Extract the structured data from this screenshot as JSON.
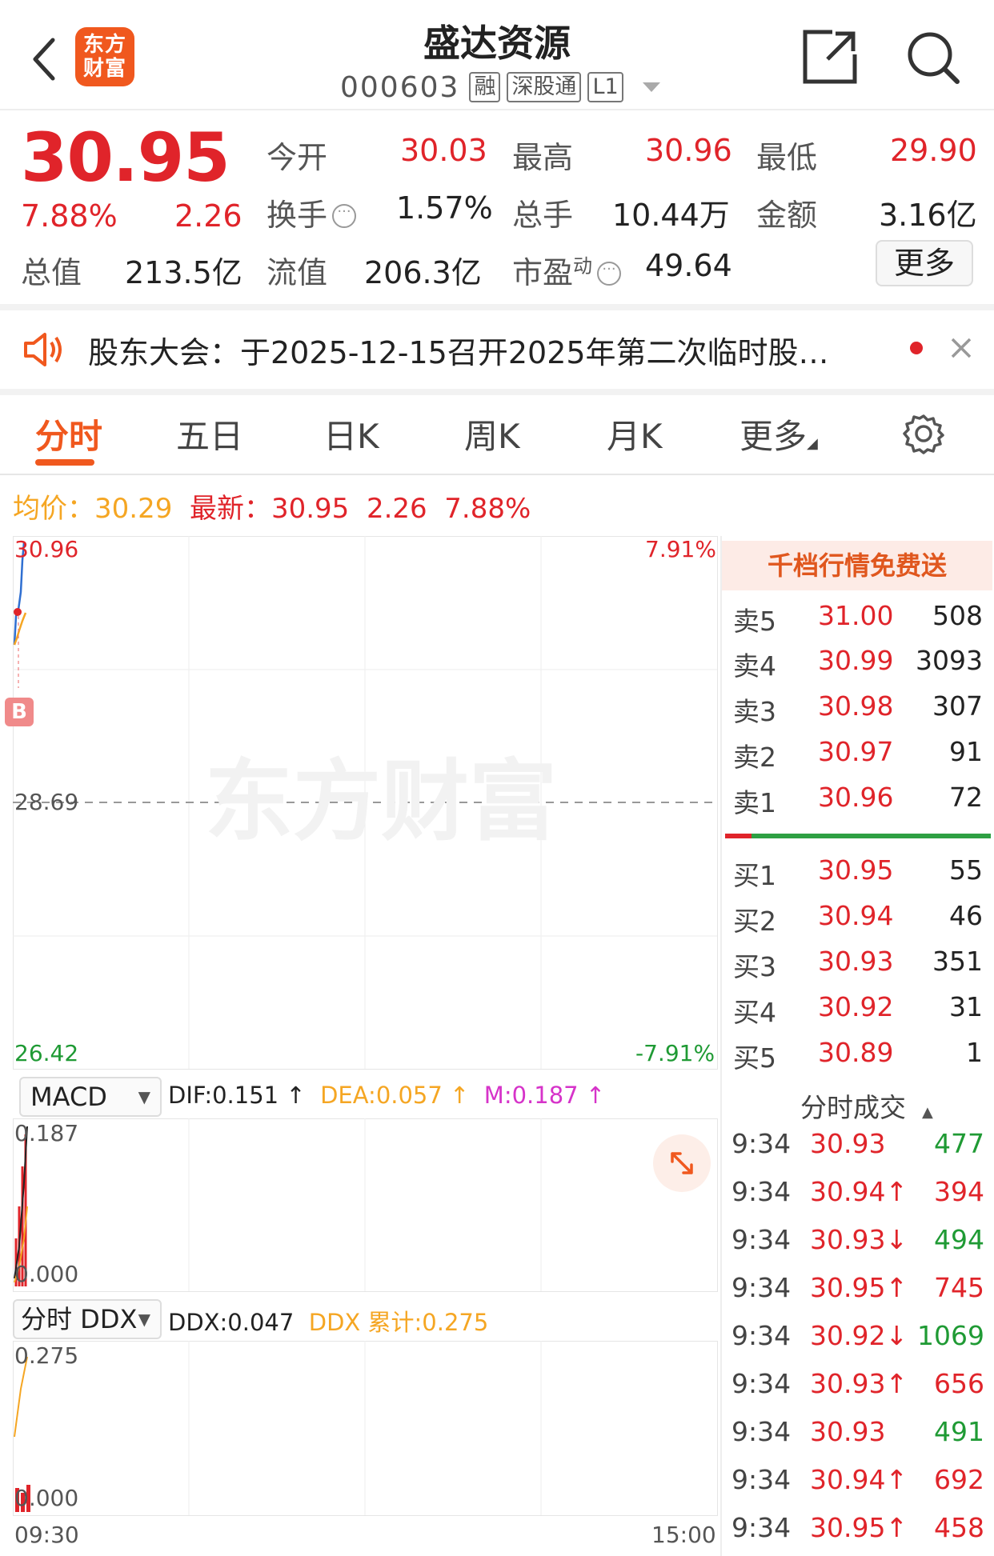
{
  "header": {
    "logo_line1": "东方",
    "logo_line2": "财富",
    "title": "盛达资源",
    "code": "000603",
    "tags": [
      "融",
      "深股通",
      "L1"
    ]
  },
  "quote": {
    "price": "30.95",
    "change_pct": "7.88%",
    "change": "2.26",
    "open_label": "今开",
    "open": "30.03",
    "high_label": "最高",
    "high": "30.96",
    "low_label": "最低",
    "low": "29.90",
    "turnover_label": "换手",
    "turnover": "1.57%",
    "volume_label": "总手",
    "volume": "10.44万",
    "amount_label": "金额",
    "amount": "3.16亿",
    "mktcap_label": "总值",
    "mktcap": "213.5亿",
    "float_label": "流值",
    "float_cap": "206.3亿",
    "pe_label": "市盈",
    "pe_sup": "动",
    "pe": "49.64",
    "more": "更多"
  },
  "notice": {
    "text": "股东大会：于2025-12-15召开2025年第二次临时股…"
  },
  "tabs": [
    "分时",
    "五日",
    "日K",
    "周K",
    "月K",
    "更多"
  ],
  "chart": {
    "avg_label": "均价：",
    "avg": "30.29",
    "latest_label": "最新：",
    "latest": "30.95",
    "latest_change": "2.26",
    "latest_pct": "7.88%",
    "y_max": "30.96",
    "y_mid": "28.69",
    "y_min": "26.42",
    "pct_max": "7.91%",
    "pct_min": "-7.91%",
    "watermark": "东方财富",
    "marker": "B",
    "time_start": "09:30",
    "time_end": "15:00"
  },
  "macd": {
    "selector": "MACD",
    "dif": "DIF:0.151 ↑",
    "dea": "DEA:0.057 ↑",
    "m": "M:0.187 ↑",
    "max": "0.187",
    "min": "0.000"
  },
  "ddx": {
    "selector": "分时 DDX",
    "ddx": "DDX:0.047",
    "ddx_cum": "DDX 累计:0.275",
    "max": "0.275",
    "min": "0.000"
  },
  "orderbook": {
    "header": "千档行情免费送",
    "asks": [
      {
        "label": "卖5",
        "price": "31.00",
        "vol": "508"
      },
      {
        "label": "卖4",
        "price": "30.99",
        "vol": "3093"
      },
      {
        "label": "卖3",
        "price": "30.98",
        "vol": "307"
      },
      {
        "label": "卖2",
        "price": "30.97",
        "vol": "91"
      },
      {
        "label": "卖1",
        "price": "30.96",
        "vol": "72"
      }
    ],
    "bids": [
      {
        "label": "买1",
        "price": "30.95",
        "vol": "55"
      },
      {
        "label": "买2",
        "price": "30.94",
        "vol": "46"
      },
      {
        "label": "买3",
        "price": "30.93",
        "vol": "351"
      },
      {
        "label": "买4",
        "price": "30.92",
        "vol": "31"
      },
      {
        "label": "买5",
        "price": "30.89",
        "vol": "1"
      }
    ],
    "buy_ratio": 0.1
  },
  "ticks": {
    "header": "分时成交",
    "rows": [
      {
        "time": "9:34",
        "price": "30.93",
        "vol": "477",
        "side": "buy"
      },
      {
        "time": "9:34",
        "price": "30.94↑",
        "vol": "394",
        "side": "sell"
      },
      {
        "time": "9:34",
        "price": "30.93↓",
        "vol": "494",
        "side": "buy"
      },
      {
        "time": "9:34",
        "price": "30.95↑",
        "vol": "745",
        "side": "sell"
      },
      {
        "time": "9:34",
        "price": "30.92↓",
        "vol": "1069",
        "side": "buy"
      },
      {
        "time": "9:34",
        "price": "30.93↑",
        "vol": "656",
        "side": "sell"
      },
      {
        "time": "9:34",
        "price": "30.93",
        "vol": "491",
        "side": "buy"
      },
      {
        "time": "9:34",
        "price": "30.94↑",
        "vol": "692",
        "side": "sell"
      },
      {
        "time": "9:34",
        "price": "30.95↑",
        "vol": "458",
        "side": "sell"
      }
    ]
  },
  "colors": {
    "up": "#e0242a",
    "down": "#1f9a34",
    "accent": "#f0581e",
    "avg": "#f5a623"
  }
}
